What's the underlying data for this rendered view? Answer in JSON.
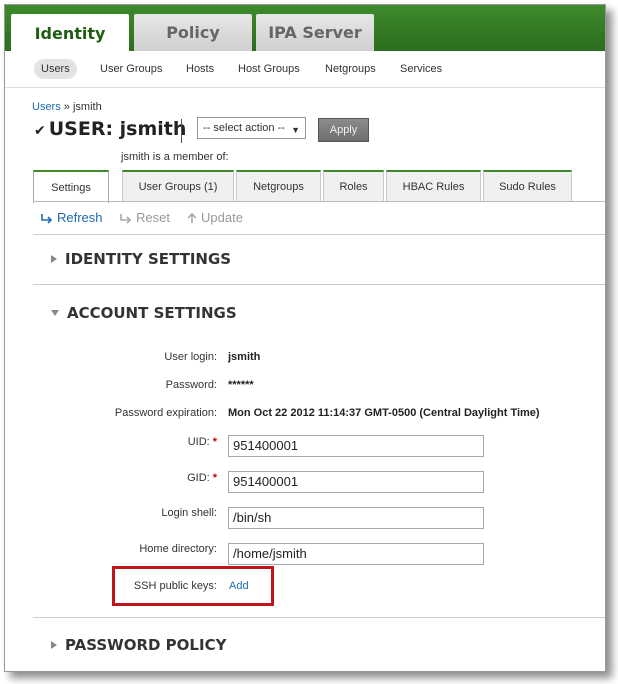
{
  "top_tabs": [
    "Identity",
    "Policy",
    "IPA Server"
  ],
  "subnav": [
    "Users",
    "User Groups",
    "Hosts",
    "Host Groups",
    "Netgroups",
    "Services"
  ],
  "breadcrumb": {
    "link": "Users",
    "separator": "»",
    "current": "jsmith"
  },
  "title": {
    "check": "✔",
    "text": "USER: jsmith"
  },
  "action": {
    "placeholder": "-- select action --",
    "caret": "▼",
    "apply": "Apply"
  },
  "member_label": "jsmith is a member of:",
  "facets": [
    "Settings",
    "User Groups (1)",
    "Netgroups",
    "Roles",
    "HBAC Rules",
    "Sudo Rules"
  ],
  "controls": {
    "refresh": "Refresh",
    "reset": "Reset",
    "update": "Update"
  },
  "icons": [
    "refresh-icon",
    "reset-icon",
    "update-icon",
    "check-icon",
    "collapse-triangle-icon",
    "expand-triangle-icon"
  ],
  "sections": {
    "identity": "IDENTITY SETTINGS",
    "account": "ACCOUNT SETTINGS",
    "password_policy": "PASSWORD POLICY"
  },
  "fields": {
    "user_login": {
      "label": "User login:",
      "value": "jsmith"
    },
    "password": {
      "label": "Password:",
      "value": "******"
    },
    "password_expiration": {
      "label": "Password expiration:",
      "value": "Mon Oct 22 2012 11:14:37 GMT-0500 (Central Daylight Time)"
    },
    "uid": {
      "label": "UID:",
      "value": "951400001"
    },
    "gid": {
      "label": "GID:",
      "value": "951400001"
    },
    "login_shell": {
      "label": "Login shell:",
      "value": "/bin/sh"
    },
    "home_directory": {
      "label": "Home directory:",
      "value": "/home/jsmith"
    },
    "ssh_keys": {
      "label": "SSH public keys:",
      "add": "Add"
    }
  },
  "required_marker": "*",
  "colors": {
    "accent_green": "#3d8a2a",
    "link_blue": "#1d6bb3",
    "highlight_red": "#c0141b"
  }
}
